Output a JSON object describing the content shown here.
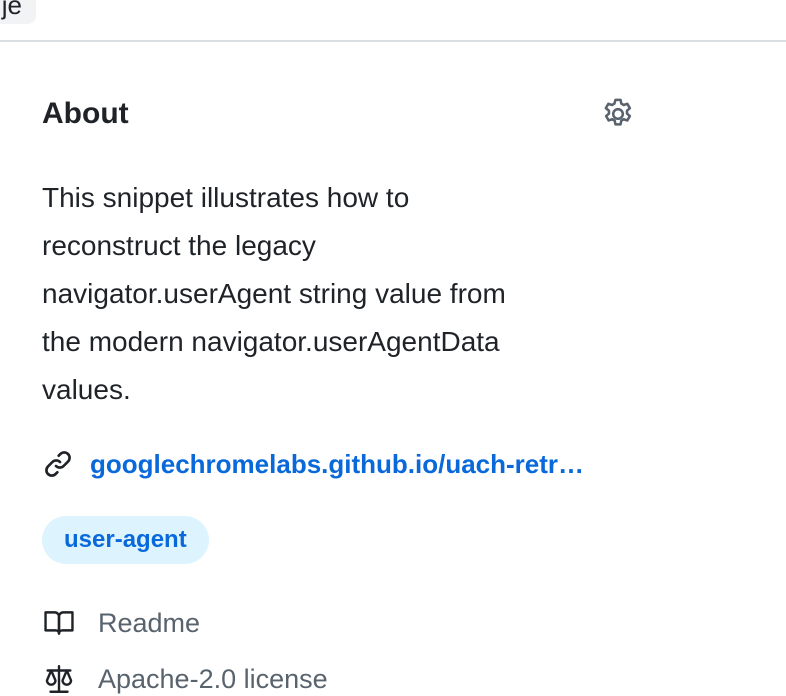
{
  "top_tab": {
    "label_fragment": "je"
  },
  "about": {
    "title": "About",
    "settings_icon": "gear-icon",
    "description_lines": [
      "This snippet illustrates how to",
      "reconstruct the legacy",
      "navigator.userAgent string value from",
      "the modern navigator.userAgentData",
      "values."
    ],
    "homepage": {
      "icon": "link-icon",
      "label": "googlechromelabs.github.io/uach-retr…"
    },
    "topics": [
      "user-agent"
    ],
    "meta": {
      "readme": {
        "icon": "book-icon",
        "label": "Readme"
      },
      "license": {
        "icon": "law-icon",
        "label": "Apache-2.0 license"
      }
    }
  },
  "colors": {
    "link": "#0969da",
    "topic_bg": "#ddf4ff",
    "muted_text": "#59636e",
    "border": "#d8dee4"
  }
}
